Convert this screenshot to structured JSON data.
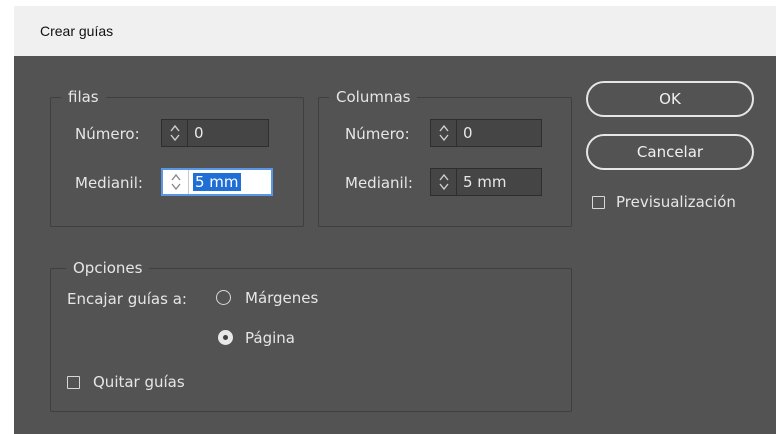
{
  "dialog": {
    "title": "Crear guías"
  },
  "rows": {
    "legend": "filas",
    "number_label": "Número:",
    "number_value": "0",
    "gutter_label": "Medianil:",
    "gutter_value": "5 mm"
  },
  "columns": {
    "legend": "Columnas",
    "number_label": "Número:",
    "number_value": "0",
    "gutter_label": "Medianil:",
    "gutter_value": "5 mm"
  },
  "options": {
    "legend": "Opciones",
    "fit_label": "Encajar guías a:",
    "fit_options": [
      {
        "label": "Márgenes",
        "selected": false
      },
      {
        "label": "Página",
        "selected": true
      }
    ],
    "remove_guides_label": "Quitar guías",
    "remove_guides_checked": false
  },
  "buttons": {
    "ok": "OK",
    "cancel": "Cancelar"
  },
  "preview": {
    "label": "Previsualización",
    "checked": false
  }
}
